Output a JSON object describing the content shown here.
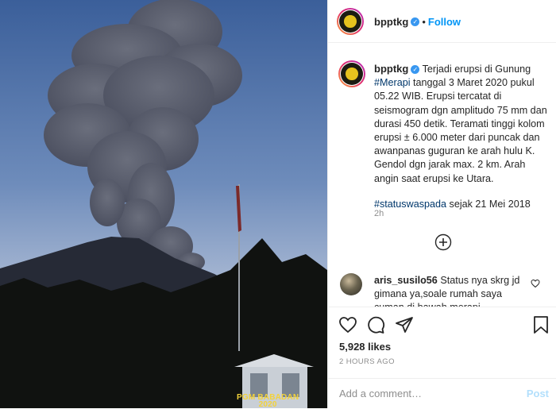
{
  "photo": {
    "watermark_line1": "PGM BABADAN",
    "watermark_line2": "2020"
  },
  "header": {
    "username": "bpptkg",
    "separator": "•",
    "follow_label": "Follow"
  },
  "caption": {
    "username": "bpptkg",
    "text_1": "Terjadi erupsi di Gunung ",
    "hashtag_1": "#Merapi",
    "text_2": " tanggal 3 Maret 2020 pukul 05.22 WIB. Erupsi tercatat di seismogram dgn amplitudo 75 mm dan durasi 450 detik. Teramati tinggi kolom erupsi ± 6.000 meter dari puncak dan awanpanas guguran ke arah hulu K. Gendol dgn jarak max. 2 km. Arah angin saat erupsi ke Utara.",
    "hashtag_2": "#statuswaspada",
    "text_3": " sejak 21 Mei 2018",
    "time": "2h"
  },
  "comment": {
    "username": "aris_susilo56",
    "text": "Status nya skrg jd gimana ya,soale rumah saya cuman di bawah merapi"
  },
  "actions": {
    "likes": "5,928 likes",
    "posted": "2 HOURS AGO"
  },
  "add_comment": {
    "placeholder": "Add a comment…",
    "post_label": "Post"
  },
  "colors": {
    "link": "#0095f6",
    "hashtag": "#00376b",
    "muted": "#8e8e8e",
    "verified": "#3897f0"
  },
  "icons": [
    "verified-badge-icon",
    "add-comments-icon",
    "heart-icon",
    "comment-icon",
    "share-icon",
    "save-icon",
    "small-heart-icon"
  ]
}
